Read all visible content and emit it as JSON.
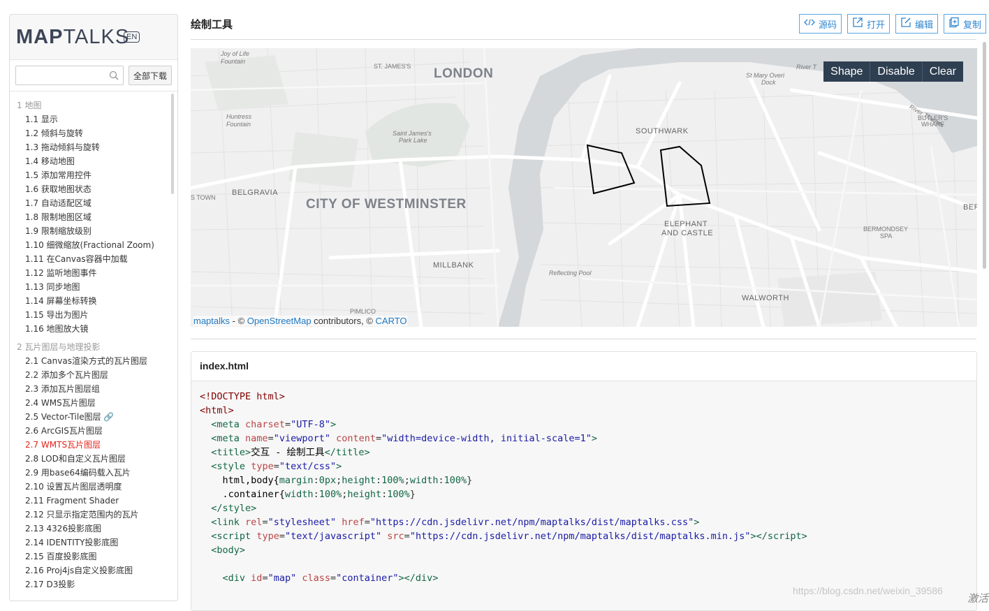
{
  "sidebar": {
    "logo_bold": "MAP",
    "logo_normal": "TALKS",
    "lang_badge": "EN",
    "search_placeholder": "",
    "download_all": "全部下载",
    "sections": [
      {
        "title": "1 地图",
        "items": [
          "1.1 显示",
          "1.2 倾斜与旋转",
          "1.3 拖动倾斜与旋转",
          "1.4 移动地图",
          "1.5 添加常用控件",
          "1.6 获取地图状态",
          "1.7 自动适配区域",
          "1.8 限制地图区域",
          "1.9 限制缩放级别",
          "1.10 细微缩放(Fractional Zoom)",
          "1.11 在Canvas容器中加载",
          "1.12 监听地图事件",
          "1.13 同步地图",
          "1.14 屏幕坐标转换",
          "1.15 导出为图片",
          "1.16 地图放大镜"
        ]
      },
      {
        "title": "2 瓦片图层与地理投影",
        "items": [
          "2.1 Canvas渲染方式的瓦片图层",
          "2.2 添加多个瓦片图层",
          "2.3 添加瓦片图层组",
          "2.4 WMS瓦片图层",
          "2.5 Vector-Tile图层 🔗",
          "2.6 ArcGIS瓦片图层",
          "2.7 WMTS瓦片图层",
          "2.8 LOD和自定义瓦片图层",
          "2.9 用base64编码载入瓦片",
          "2.10 设置瓦片图层透明度",
          "2.11 Fragment Shader",
          "2.12 只显示指定范围内的瓦片",
          "2.13 4326投影底图",
          "2.14 IDENTITY投影底图",
          "2.15 百度投影底图",
          "2.16 Proj4js自定义投影底图",
          "2.17 D3投影"
        ]
      }
    ],
    "active_item": "2.7 WMTS瓦片图层"
  },
  "header": {
    "title": "绘制工具",
    "buttons": [
      {
        "label": "源码",
        "icon": "code-icon"
      },
      {
        "label": "打开",
        "icon": "external-link-icon"
      },
      {
        "label": "编辑",
        "icon": "edit-icon"
      },
      {
        "label": "复制",
        "icon": "copy-icon"
      }
    ]
  },
  "map": {
    "draw_toolbar": [
      "Shape",
      "Disable",
      "Clear"
    ],
    "labels": {
      "london": "LONDON",
      "westminster": "CITY OF WESTMINSTER",
      "southwark": "SOUTHWARK",
      "belgravia": "BELGRAVIA",
      "millbank": "MILLBANK",
      "elephant1": "ELEPHANT",
      "elephant2": "AND CASTLE",
      "walworth": "WALWORTH",
      "bermondsey1": "BERMONDSEY",
      "bermondsey2": "SPA",
      "stjames": "ST. JAMES'S",
      "butlers1": "BUTLER'S",
      "butlers2": "WHARF",
      "pimlico": "PIMLICO",
      "town": "S TOWN",
      "ber": "BER",
      "joy1": "Joy of Life",
      "joy2": "Fountain",
      "huntress1": "Huntress",
      "huntress2": "Fountain",
      "stjamespark1": "Saint James's",
      "stjamespark2": "Park Lake",
      "stmary1": "St Mary Overi",
      "stmary2": "Dock",
      "reflecting": "Reflecting Pool",
      "river": "River T",
      "rt_thames": "River Thames"
    },
    "attribution": {
      "maptalks": "maptalks",
      "sep1": " - © ",
      "osm": "OpenStreetMap",
      "sep2": " contributors, © ",
      "carto": "CARTO"
    }
  },
  "code": {
    "filename": "index.html"
  },
  "watermark": "https://blog.csdn.net/weixin_39586",
  "activate_text": "激活"
}
